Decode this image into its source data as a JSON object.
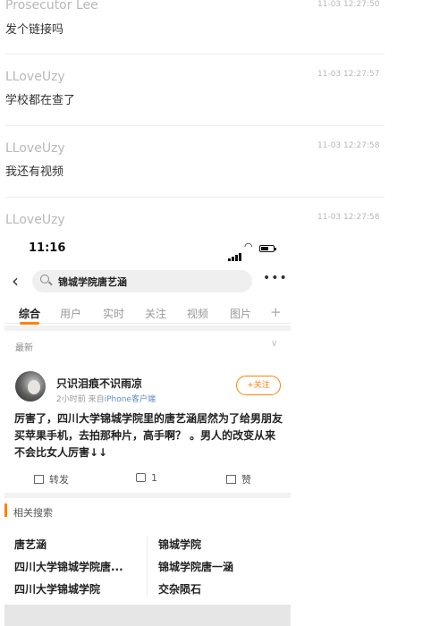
{
  "comments": [
    {
      "user": "Prosecutor Lee",
      "time": "11-03 12:27:50",
      "text": "发个链接吗"
    },
    {
      "user": "LLoveUzy",
      "time": "11-03 12:27:57",
      "text": "学校都在查了"
    },
    {
      "user": "LLoveUzy",
      "time": "11-03 12:27:58",
      "text": "我还有视频"
    },
    {
      "user": "LLoveUzy",
      "time": "11-03 12:27:58",
      "text": ""
    }
  ],
  "screenshot": {
    "status": {
      "time": "11:16"
    },
    "search": {
      "query": "锦城学院唐艺涵",
      "back_icon": "back-chevron-icon",
      "more_icon": "more-dots-icon"
    },
    "tabs": [
      {
        "label": "综合"
      },
      {
        "label": "用户"
      },
      {
        "label": "实时"
      },
      {
        "label": "关注"
      },
      {
        "label": "视频"
      },
      {
        "label": "图片"
      }
    ],
    "tab_plus": "+",
    "latest_label": "最新",
    "post": {
      "author": "只识泪痕不识雨凉",
      "meta_time": "2小时前 来自",
      "meta_source": "iPhone客户端",
      "follow_label": "+关注",
      "body": "厉害了，四川大学锦城学院里的唐艺涵居然为了给男朋友买苹果手机，去拍那种片，高手啊？ 。男人的改变从来不会比女人厉害↓↓",
      "repost_label": "转发",
      "comment_count": "1",
      "like_label": "赞"
    },
    "related": {
      "title": "相关搜索",
      "items": [
        "唐艺涵",
        "锦城学院",
        "四川大学锦城学院唐...",
        "锦城学院唐一涵",
        "四川大学锦城学院",
        "交杂陨石"
      ]
    },
    "colors": {
      "accent": "#ff8200",
      "link": "#5b8ec9"
    }
  }
}
